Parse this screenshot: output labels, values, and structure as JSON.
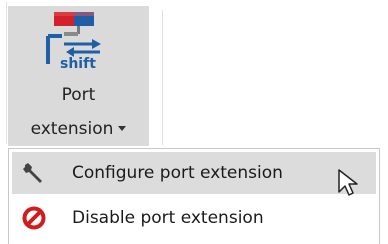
{
  "ribbon": {
    "port_extension_button": {
      "label_line1": "Port",
      "label_line2": "extension",
      "icon": "port-extension-shift-icon",
      "icon_text": "shift"
    }
  },
  "menu": {
    "items": [
      {
        "label": "Configure port extension",
        "icon": "wrench-icon",
        "hovered": true
      },
      {
        "label": "Disable port extension",
        "icon": "disable-icon",
        "hovered": false
      }
    ]
  },
  "colors": {
    "button_pressed_bg": "#dadada",
    "menu_hover_bg": "#dcdcdc",
    "icon_red": "#d4202a",
    "icon_blue": "#1f5fa8",
    "disable_red": "#d01c1c"
  }
}
